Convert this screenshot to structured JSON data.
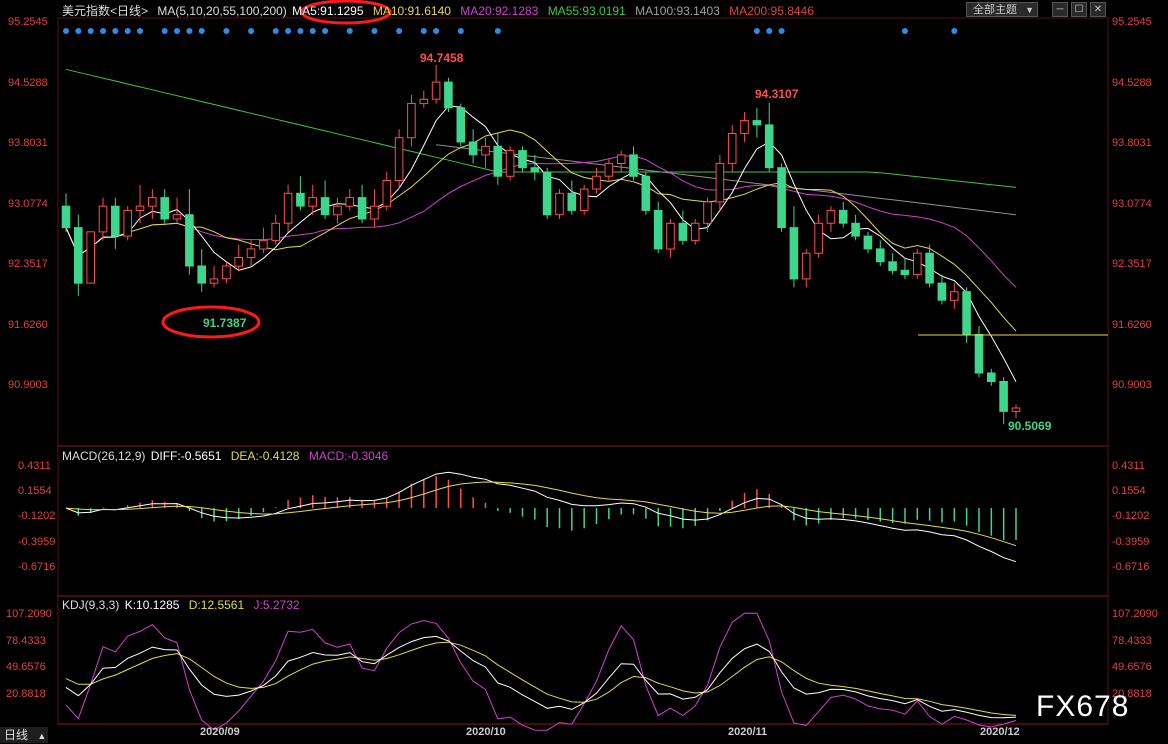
{
  "header": {
    "title": "美元指数<日线>",
    "ma_label": "MA(5,10,20,55,100,200)",
    "ma5": "MA5:91.1295",
    "ma10": "MA10:91.6140",
    "ma20": "MA20:92.1283",
    "ma55": "MA55:93.0191",
    "ma100": "MA100:93.1403",
    "ma200": "MA200:95.8446",
    "theme_button": "全部主题",
    "theme_arrow": "▼"
  },
  "colors": {
    "up": "#ff4d4d",
    "down": "#3dd68c",
    "ma5": "#ffffff",
    "ma10": "#e6d94a",
    "ma20": "#d040d0",
    "ma55": "#3cc83c",
    "ma100": "#909090",
    "ma200": "#e04040",
    "axis_text": "#e04040",
    "signal_dot": "#2e8ce6",
    "highlight_oval": "#ff1a1a"
  },
  "price_axis": [
    "95.2545",
    "94.5288",
    "93.8031",
    "93.0774",
    "92.3517",
    "91.6260",
    "90.9003"
  ],
  "macd": {
    "header": "MACD(26,12,9)",
    "diff": "DIFF:-0.5651",
    "dea": "DEA:-0.4128",
    "macd": "MACD:-0.3046",
    "axis": [
      "0.4311",
      "0.1554",
      "-0.1202",
      "-0.3959",
      "-0.6716"
    ]
  },
  "kdj": {
    "header": "KDJ(9,3,3)",
    "k": "K:10.1285",
    "d": "D:12.5561",
    "j": "J:5.2732",
    "axis": [
      "107.2090",
      "78.4333",
      "49.6576",
      "20.8818"
    ]
  },
  "x_axis": [
    "2020/09",
    "2020/10",
    "2020/11",
    "2020/12"
  ],
  "annotations": {
    "high1": "94.7458",
    "high2": "94.3107",
    "low1": "91.7387",
    "low2": "90.5069"
  },
  "footer": {
    "period_button": "日线",
    "period_arrow": "▲"
  },
  "watermark": "FX678",
  "chart_data": {
    "type": "candlestick",
    "title": "美元指数",
    "x_labels": [
      "2020/09",
      "2020/10",
      "2020/11",
      "2020/12"
    ],
    "price_range": [
      90.6,
      95.3
    ],
    "candles": [
      [
        93.1,
        93.25,
        92.8,
        92.85
      ],
      [
        92.85,
        93.0,
        92.05,
        92.2
      ],
      [
        92.2,
        92.4,
        92.2,
        92.8
      ],
      [
        92.8,
        93.2,
        92.7,
        93.1
      ],
      [
        93.1,
        93.2,
        92.6,
        92.75
      ],
      [
        92.75,
        93.1,
        92.7,
        93.05
      ],
      [
        93.05,
        93.35,
        92.9,
        93.1
      ],
      [
        93.1,
        93.3,
        92.95,
        93.2
      ],
      [
        93.2,
        93.3,
        92.9,
        92.95
      ],
      [
        92.95,
        93.2,
        92.9,
        93.0
      ],
      [
        93.0,
        93.3,
        92.3,
        92.4
      ],
      [
        92.4,
        92.6,
        92.1,
        92.2
      ],
      [
        92.2,
        92.4,
        92.15,
        92.25
      ],
      [
        92.25,
        92.45,
        92.2,
        92.4
      ],
      [
        92.4,
        92.65,
        92.35,
        92.5
      ],
      [
        92.5,
        92.7,
        92.4,
        92.6
      ],
      [
        92.6,
        92.85,
        92.55,
        92.7
      ],
      [
        92.7,
        93.0,
        92.65,
        92.9
      ],
      [
        92.9,
        93.35,
        92.8,
        93.25
      ],
      [
        93.25,
        93.45,
        93.05,
        93.1
      ],
      [
        93.1,
        93.35,
        93.0,
        93.2
      ],
      [
        93.2,
        93.4,
        92.95,
        93.0
      ],
      [
        93.0,
        93.2,
        92.9,
        93.1
      ],
      [
        93.1,
        93.3,
        93.05,
        93.2
      ],
      [
        93.2,
        93.35,
        92.9,
        92.95
      ],
      [
        92.95,
        93.3,
        92.85,
        93.1
      ],
      [
        93.1,
        93.5,
        93.05,
        93.4
      ],
      [
        93.4,
        94.0,
        93.3,
        93.9
      ],
      [
        93.9,
        94.4,
        93.8,
        94.3
      ],
      [
        94.3,
        94.45,
        94.25,
        94.35
      ],
      [
        94.35,
        94.75,
        94.3,
        94.55
      ],
      [
        94.55,
        94.6,
        94.2,
        94.25
      ],
      [
        94.25,
        94.3,
        93.8,
        93.85
      ],
      [
        93.85,
        94.0,
        93.6,
        93.7
      ],
      [
        93.7,
        93.9,
        93.55,
        93.8
      ],
      [
        93.8,
        93.95,
        93.35,
        93.45
      ],
      [
        93.45,
        93.8,
        93.4,
        93.75
      ],
      [
        93.75,
        93.8,
        93.5,
        93.55
      ],
      [
        93.55,
        93.7,
        93.4,
        93.5
      ],
      [
        93.5,
        93.55,
        92.95,
        93.0
      ],
      [
        93.0,
        93.3,
        92.95,
        93.25
      ],
      [
        93.25,
        93.4,
        93.0,
        93.05
      ],
      [
        93.05,
        93.35,
        93.0,
        93.3
      ],
      [
        93.3,
        93.55,
        93.25,
        93.45
      ],
      [
        93.45,
        93.65,
        93.4,
        93.6
      ],
      [
        93.6,
        93.75,
        93.5,
        93.7
      ],
      [
        93.7,
        93.8,
        93.4,
        93.45
      ],
      [
        93.45,
        93.5,
        93.0,
        93.05
      ],
      [
        93.05,
        93.15,
        92.55,
        92.6
      ],
      [
        92.6,
        92.95,
        92.5,
        92.9
      ],
      [
        92.9,
        93.05,
        92.65,
        92.7
      ],
      [
        92.7,
        92.95,
        92.65,
        92.9
      ],
      [
        92.9,
        93.2,
        92.8,
        93.15
      ],
      [
        93.15,
        93.7,
        93.05,
        93.6
      ],
      [
        93.6,
        94.05,
        93.5,
        93.95
      ],
      [
        93.95,
        94.2,
        93.85,
        94.1
      ],
      [
        94.1,
        94.25,
        93.9,
        94.05
      ],
      [
        94.05,
        94.31,
        93.5,
        93.55
      ],
      [
        93.55,
        93.6,
        92.8,
        92.85
      ],
      [
        92.85,
        93.1,
        92.15,
        92.25
      ],
      [
        92.25,
        92.6,
        92.15,
        92.55
      ],
      [
        92.55,
        93.0,
        92.5,
        92.9
      ],
      [
        92.9,
        93.1,
        92.8,
        93.05
      ],
      [
        93.05,
        93.15,
        92.85,
        92.9
      ],
      [
        92.9,
        93.0,
        92.7,
        92.75
      ],
      [
        92.75,
        92.8,
        92.55,
        92.6
      ],
      [
        92.6,
        92.7,
        92.4,
        92.45
      ],
      [
        92.45,
        92.55,
        92.3,
        92.35
      ],
      [
        92.35,
        92.5,
        92.25,
        92.3
      ],
      [
        92.3,
        92.6,
        92.25,
        92.55
      ],
      [
        92.55,
        92.65,
        92.15,
        92.2
      ],
      [
        92.2,
        92.3,
        91.95,
        92.0
      ],
      [
        92.0,
        92.2,
        91.9,
        92.1
      ],
      [
        92.1,
        92.15,
        91.5,
        91.6
      ],
      [
        91.6,
        91.7,
        91.1,
        91.15
      ],
      [
        91.15,
        91.2,
        91.0,
        91.05
      ],
      [
        91.05,
        91.1,
        90.55,
        90.7
      ],
      [
        90.7,
        90.78,
        90.62,
        90.74
      ]
    ],
    "macd_range": [
      -0.78,
      0.5
    ],
    "kdj_range": [
      5,
      115
    ]
  }
}
